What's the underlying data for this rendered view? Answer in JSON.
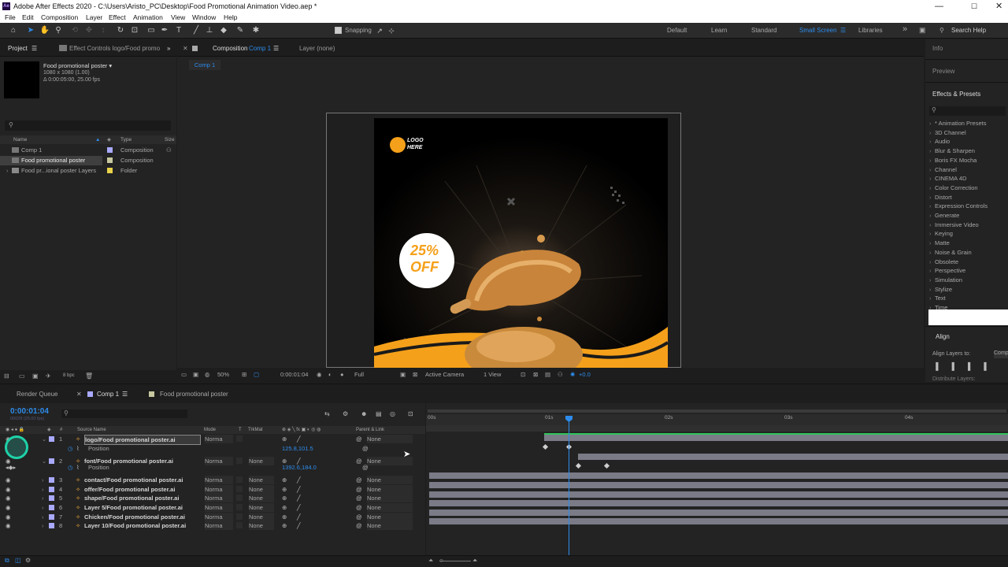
{
  "window": {
    "title": "Adobe After Effects 2020 - C:\\Users\\Aristo_PC\\Desktop\\Food Promotional Animation Video.aep *"
  },
  "menu": [
    "File",
    "Edit",
    "Composition",
    "Layer",
    "Effect",
    "Animation",
    "View",
    "Window",
    "Help"
  ],
  "toolbar": {
    "snapping": "Snapping",
    "workspaces": [
      "Default",
      "Learn",
      "Standard",
      "Small Screen",
      "Libraries"
    ],
    "active_workspace": "Small Screen",
    "search_help": "Search Help"
  },
  "project": {
    "tab": "Project",
    "effect_controls": "Effect Controls logo/Food promo",
    "item_name": "Food promotional poster ▾",
    "item_size": "1080 x 1080 (1.00)",
    "item_duration": "Δ 0:00:05:00, 25.00 fps",
    "search": "",
    "col_name": "Name",
    "col_type": "Type",
    "col_size": "Size",
    "items": [
      {
        "name": "Comp 1",
        "type": "Composition",
        "label": "#a9a9ff"
      },
      {
        "name": "Food promotional poster",
        "type": "Composition",
        "label": "#c8c8a0"
      },
      {
        "name": "Food pr...ional poster Layers",
        "type": "Folder",
        "label": "#e8d34a"
      }
    ],
    "bpc": "8 bpc"
  },
  "composition": {
    "tab": "Composition",
    "tab_name": "Comp 1",
    "layer_tab": "Layer (none)",
    "breadcrumb": "Comp 1",
    "zoom": "50%",
    "time": "0:00:01:04",
    "resolution": "Full",
    "camera": "Active Camera",
    "view": "1 View",
    "exposure": "+0.0"
  },
  "poster": {
    "logo_line1": "LOGO",
    "logo_line2": "HERE",
    "badge_line1": "25%",
    "badge_line2": "OFF"
  },
  "right_panel": {
    "info": "Info",
    "preview": "Preview",
    "effects": "Effects & Presets",
    "search": "",
    "effects_list": [
      "* Animation Presets",
      "3D Channel",
      "Audio",
      "Blur & Sharpen",
      "Boris FX Mocha",
      "Channel",
      "CINEMA 4D",
      "Color Correction",
      "Distort",
      "Expression Controls",
      "Generate",
      "Immersive Video",
      "Keying",
      "Matte",
      "Noise & Grain",
      "Obsolete",
      "Perspective",
      "Simulation",
      "Stylize",
      "Text",
      "Time"
    ],
    "align": "Align",
    "align_to_label": "Align Layers to:",
    "align_to_value": "Composi",
    "distribute": "Distribute Layers:"
  },
  "timeline": {
    "tabs": [
      "Render Queue",
      "Comp 1",
      "Food promotional poster"
    ],
    "timecode": "0:00:01:04",
    "fps": "00029 (25.00 fps)",
    "headers": {
      "source": "Source Name",
      "mode": "Mode",
      "t": "T",
      "trkmat": "TrkMat",
      "parent": "Parent & Link"
    },
    "ruler": [
      "00s",
      "01s",
      "02s",
      "03s",
      "04s"
    ],
    "layers": [
      {
        "num": "1",
        "name": "logo/Food promotional poster.ai",
        "mode": "Norma",
        "trkmat": "",
        "parent": "None"
      },
      {
        "num": "2",
        "name": "font/Food promotional poster.ai",
        "mode": "Norma",
        "trkmat": "None",
        "parent": "None"
      },
      {
        "num": "3",
        "name": "contact/Food promotional poster.ai",
        "mode": "Norma",
        "trkmat": "None",
        "parent": "None"
      },
      {
        "num": "4",
        "name": "offer/Food promotional poster.ai",
        "mode": "Norma",
        "trkmat": "None",
        "parent": "None"
      },
      {
        "num": "5",
        "name": "shape/Food promotional poster.ai",
        "mode": "Norma",
        "trkmat": "None",
        "parent": "None"
      },
      {
        "num": "6",
        "name": "Layer 5/Food promotional poster.ai",
        "mode": "Norma",
        "trkmat": "None",
        "parent": "None"
      },
      {
        "num": "7",
        "name": "Chicken/Food promotional poster.ai",
        "mode": "Norma",
        "trkmat": "None",
        "parent": "None"
      },
      {
        "num": "8",
        "name": "Layer 10/Food promotional poster.ai",
        "mode": "Norma",
        "trkmat": "None",
        "parent": "None"
      }
    ],
    "position_label": "Position",
    "pos1": "125.8,101.5",
    "pos2": "1392.6,184.0"
  }
}
